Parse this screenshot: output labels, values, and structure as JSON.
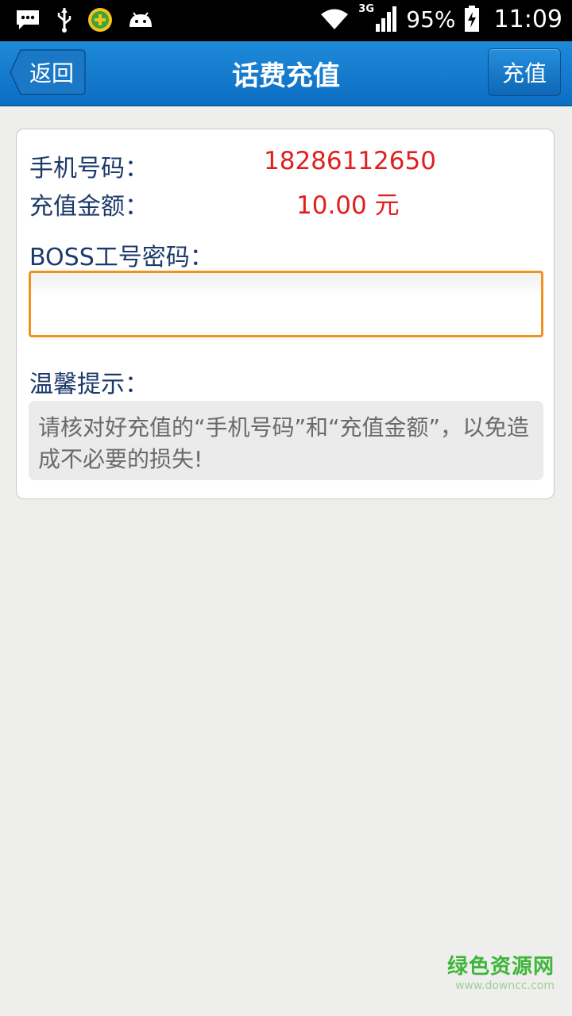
{
  "status_bar": {
    "icons_left": [
      "message-icon",
      "usb-icon",
      "app-360-icon",
      "android-icon"
    ],
    "signal_label": "3G",
    "battery_percent": "95%",
    "time": "11:09"
  },
  "header": {
    "back_label": "返回",
    "title": "话费充值",
    "action_label": "充值"
  },
  "form": {
    "phone_label": "手机号码：",
    "phone_value": "18286112650",
    "amount_label": "充值金额：",
    "amount_value": "10.00 元",
    "boss_label": "BOSS工号密码：",
    "boss_value": "",
    "tip_title": "温馨提示：",
    "tip_text": "请核对好充值的“手机号码”和“充值金额”，以免造成不必要的损失!"
  },
  "watermark": {
    "main": "绿色资源网",
    "sub": "www.downcc.com"
  },
  "colors": {
    "header_blue": "#1479cf",
    "value_red": "#e0201e",
    "label_navy": "#1c3a6a",
    "input_border_orange": "#f0921e"
  }
}
